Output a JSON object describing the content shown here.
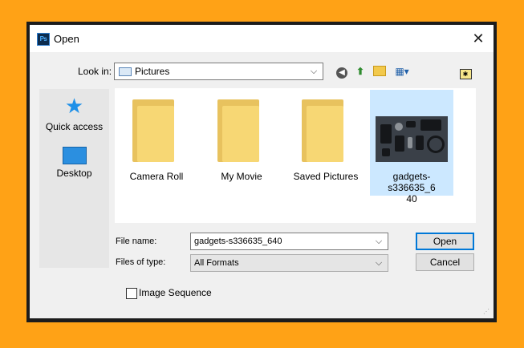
{
  "window": {
    "title": "Open",
    "app_icon_text": "Ps"
  },
  "lookin": {
    "label": "Look in:",
    "value": "Pictures"
  },
  "places": [
    {
      "label": "Quick access"
    },
    {
      "label": "Desktop"
    }
  ],
  "files": [
    {
      "label": "Camera Roll",
      "type": "folder"
    },
    {
      "label": "My Movie",
      "type": "folder"
    },
    {
      "label": "Saved Pictures",
      "type": "folder"
    },
    {
      "label": "gadgets-s336635_6\n40",
      "type": "image",
      "selected": true
    }
  ],
  "filename": {
    "label": "File name:",
    "value": "gadgets-s336635_640"
  },
  "filetype": {
    "label": "Files of type:",
    "value": "All Formats"
  },
  "buttons": {
    "open": "Open",
    "cancel": "Cancel"
  },
  "image_sequence": {
    "label": "Image Sequence",
    "checked": false
  },
  "colors": {
    "background": "#ffa216",
    "selection": "#cce8ff",
    "accent": "#0078d7"
  }
}
